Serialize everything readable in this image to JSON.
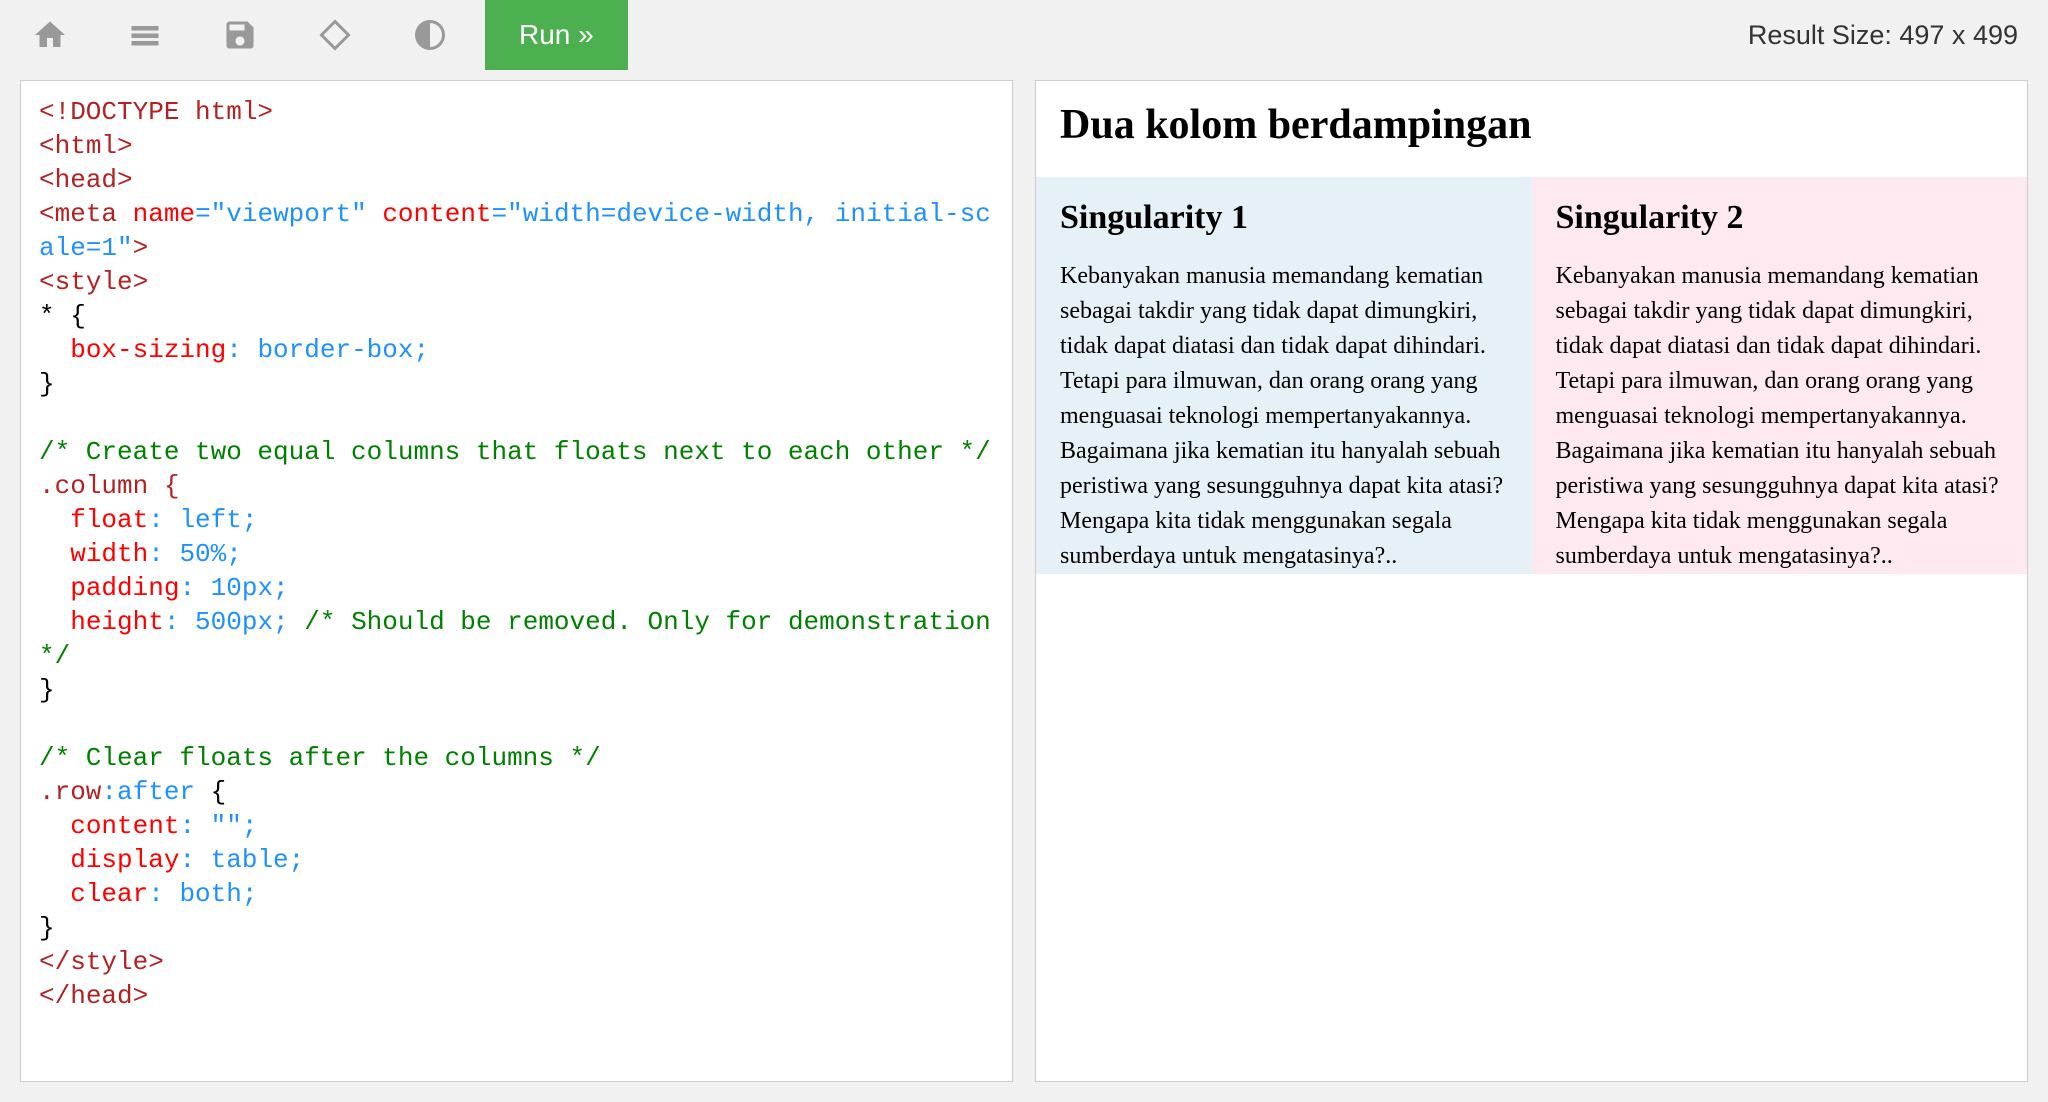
{
  "toolbar": {
    "run_label": "Run »",
    "result_size": "Result Size: 497  x  499"
  },
  "editor": {
    "l1": "<!DOCTYPE html>",
    "l2_open": "<",
    "l2_tag": "html",
    "l2_close": ">",
    "l3_open": "<",
    "l3_tag": "head",
    "l3_close": ">",
    "l4_open": "<",
    "l4_tag": "meta",
    "l4_a1": "name",
    "l4_v1": "=\"viewport\"",
    "l4_a2": "content",
    "l4_v2": "=\"width=device-width, initial-scale=1\"",
    "l4_close": ">",
    "l5_open": "<",
    "l5_tag": "style",
    "l5_close": ">",
    "css_all": "* {\n  ",
    "p_boxsz": "box-sizing",
    "v_boxsz": ": border-box;",
    "brace_c1": "\n}",
    "cm1": "\n\n/* Create two equal columns that floats next to each other */",
    "sel_col": "\n.column {",
    "p_float": "\n  float",
    "v_float": ": left;",
    "p_width": "\n  width",
    "v_width": ": 50%;",
    "p_pad": "\n  padding",
    "v_pad": ": 10px;",
    "p_height": "\n  height",
    "v_height": ": 500px;",
    "cm2": " /* Should be removed. Only for demonstration */",
    "brace_c2": "\n}",
    "cm3": "\n\n/* Clear floats after the columns */",
    "sel_row": "\n.row",
    "pseudo": ":after",
    "brace_o3": " {",
    "p_cont": "\n  content",
    "v_cont": ": \"\";",
    "p_disp": "\n  display",
    "v_disp": ": table;",
    "p_clear": "\n  clear",
    "v_clear": ": both;",
    "brace_c3": "\n}",
    "l_style_c_o": "\n</",
    "l_style_c_t": "style",
    "l_style_c_c": ">",
    "l_head_c_o": "\n</",
    "l_head_c_t": "head",
    "l_head_c_c": ">"
  },
  "preview": {
    "title": "Dua kolom berdampingan",
    "col1_title": "Singularity 1",
    "col2_title": "Singularity 2",
    "col_text": "Kebanyakan manusia memandang kematian sebagai takdir yang tidak dapat dimungkiri, tidak dapat diatasi dan tidak dapat dihindari. Tetapi para ilmuwan, dan orang orang yang menguasai teknologi mempertanyakannya. Bagaimana jika kematian itu hanyalah sebuah peristiwa yang sesungguhnya dapat kita atasi? Mengapa kita tidak menggunakan segala sumberdaya untuk mengatasinya?.."
  }
}
